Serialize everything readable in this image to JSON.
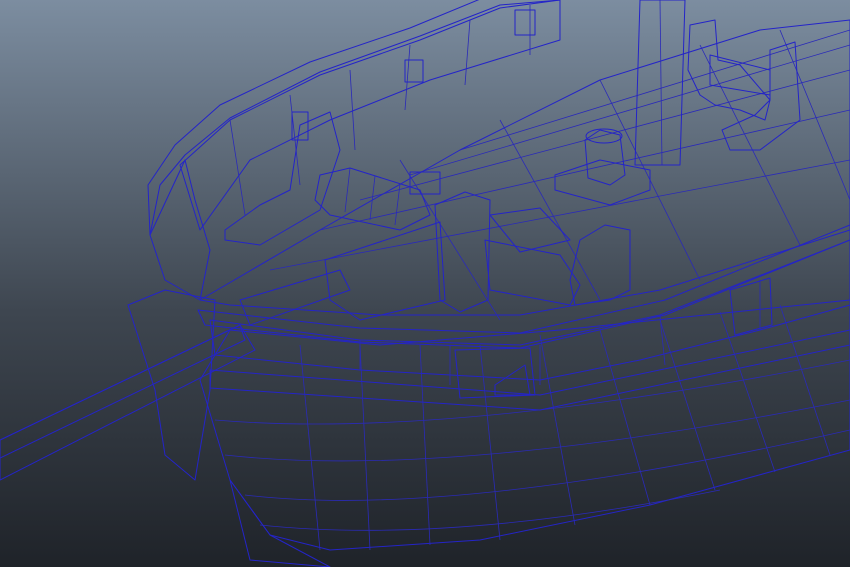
{
  "viewport": {
    "background_top": "#7c8da0",
    "background_bottom": "#1f2329",
    "mesh_face_light": "#6b6b6b",
    "mesh_face_mid": "#4f4f4f",
    "mesh_face_dark": "#353535",
    "wireframe_color": "#2424c8"
  }
}
